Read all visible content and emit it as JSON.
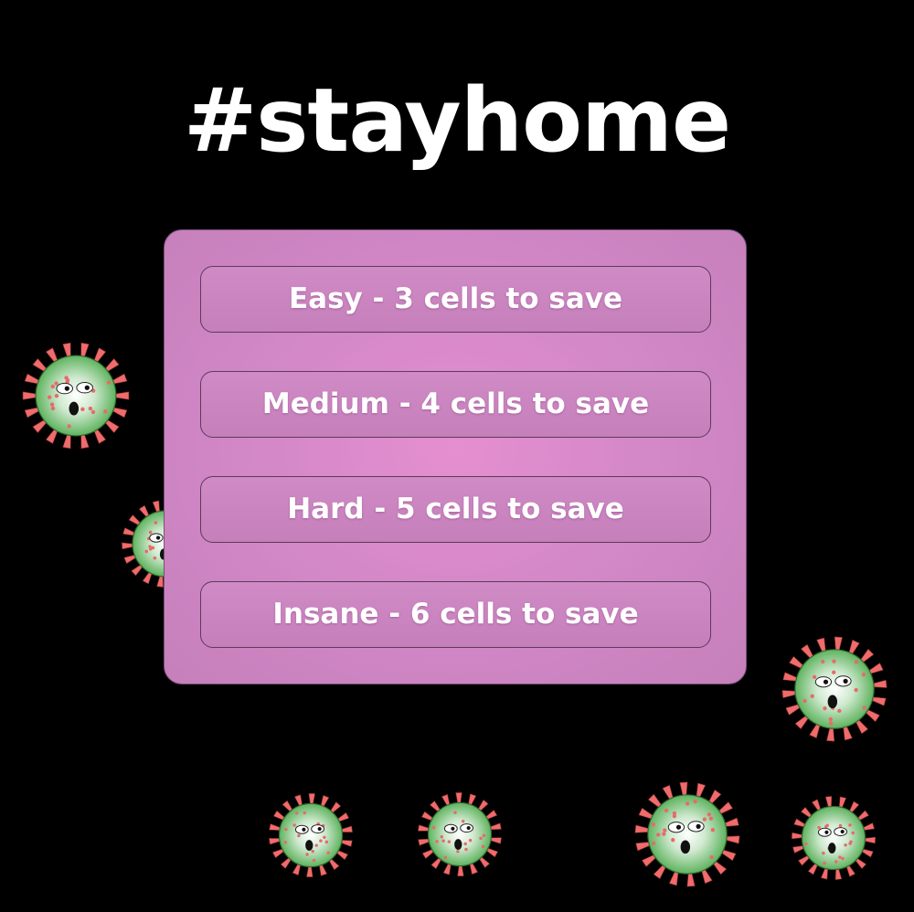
{
  "title": "#stayhome",
  "menu": {
    "buttons": [
      {
        "label": "Easy - 3 cells to save"
      },
      {
        "label": "Medium - 4 cells to save"
      },
      {
        "label": "Hard - 5 cells to save"
      },
      {
        "label": "Insane - 6 cells to save"
      }
    ]
  },
  "colors": {
    "background": "#000000",
    "panel": "#d488c8",
    "virus_body": "#5fb35f",
    "virus_spike": "#f06b6b"
  },
  "sprites": {
    "virus_icon": "virus-icon",
    "count": 8
  }
}
